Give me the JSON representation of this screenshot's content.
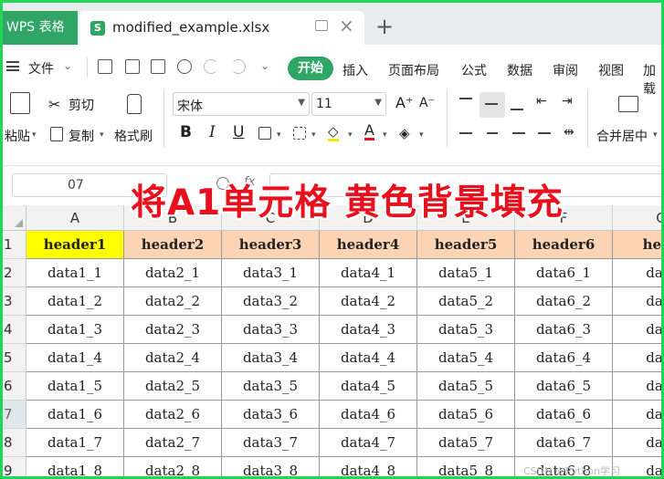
{
  "titlebar": {
    "app_tab": "WPS 表格",
    "doc_tab": "modified_example.xlsx"
  },
  "menubar": {
    "file": "文件",
    "start": "开始",
    "items": [
      "插入",
      "页面布局",
      "公式",
      "数据",
      "审阅",
      "视图",
      "加载"
    ]
  },
  "ribbon": {
    "paste": "粘贴",
    "cut": "剪切",
    "copy": "复制",
    "format_painter": "格式刷",
    "font_name": "宋体",
    "font_size": "11",
    "bold": "B",
    "italic": "I",
    "underline": "U",
    "merge_center": "合并居中"
  },
  "formula_bar": {
    "name_box": "07",
    "content": ""
  },
  "overlay": {
    "text": "将A1单元格 黄色背景填充"
  },
  "sheet": {
    "columns": [
      "A",
      "B",
      "C",
      "D",
      "E",
      "F",
      "G"
    ],
    "rows": [
      "1",
      "2",
      "3",
      "4",
      "5",
      "6",
      "7",
      "8",
      "9"
    ],
    "header_row": [
      "header1",
      "header2",
      "header3",
      "header4",
      "header5",
      "header6",
      "head"
    ],
    "data": [
      [
        "data1_1",
        "data2_1",
        "data3_1",
        "data4_1",
        "data5_1",
        "data6_1",
        "data"
      ],
      [
        "data1_2",
        "data2_2",
        "data3_2",
        "data4_2",
        "data5_2",
        "data6_2",
        "data"
      ],
      [
        "data1_3",
        "data2_3",
        "data3_3",
        "data4_3",
        "data5_3",
        "data6_3",
        "data"
      ],
      [
        "data1_4",
        "data2_4",
        "data3_4",
        "data4_4",
        "data5_4",
        "data6_4",
        "data"
      ],
      [
        "data1_5",
        "data2_5",
        "data3_5",
        "data4_5",
        "data5_5",
        "data6_5",
        "data"
      ],
      [
        "data1_6",
        "data2_6",
        "data3_6",
        "data4_6",
        "data5_6",
        "data6_6",
        "data"
      ],
      [
        "data1_7",
        "data2_7",
        "data3_7",
        "data4_7",
        "data5_7",
        "data6_7",
        "data"
      ],
      [
        "data1_8",
        "data2_8",
        "data3_8",
        "data4_8",
        "data5_8",
        "data6_8",
        "data"
      ]
    ],
    "header_fill": "#fbd4b4",
    "a1_fill": "#ffff00"
  },
  "watermark": "CSDN @Python学习",
  "colors": {
    "accent": "#2fa566",
    "frame": "#1fd655",
    "overlay": "#e8101d"
  }
}
